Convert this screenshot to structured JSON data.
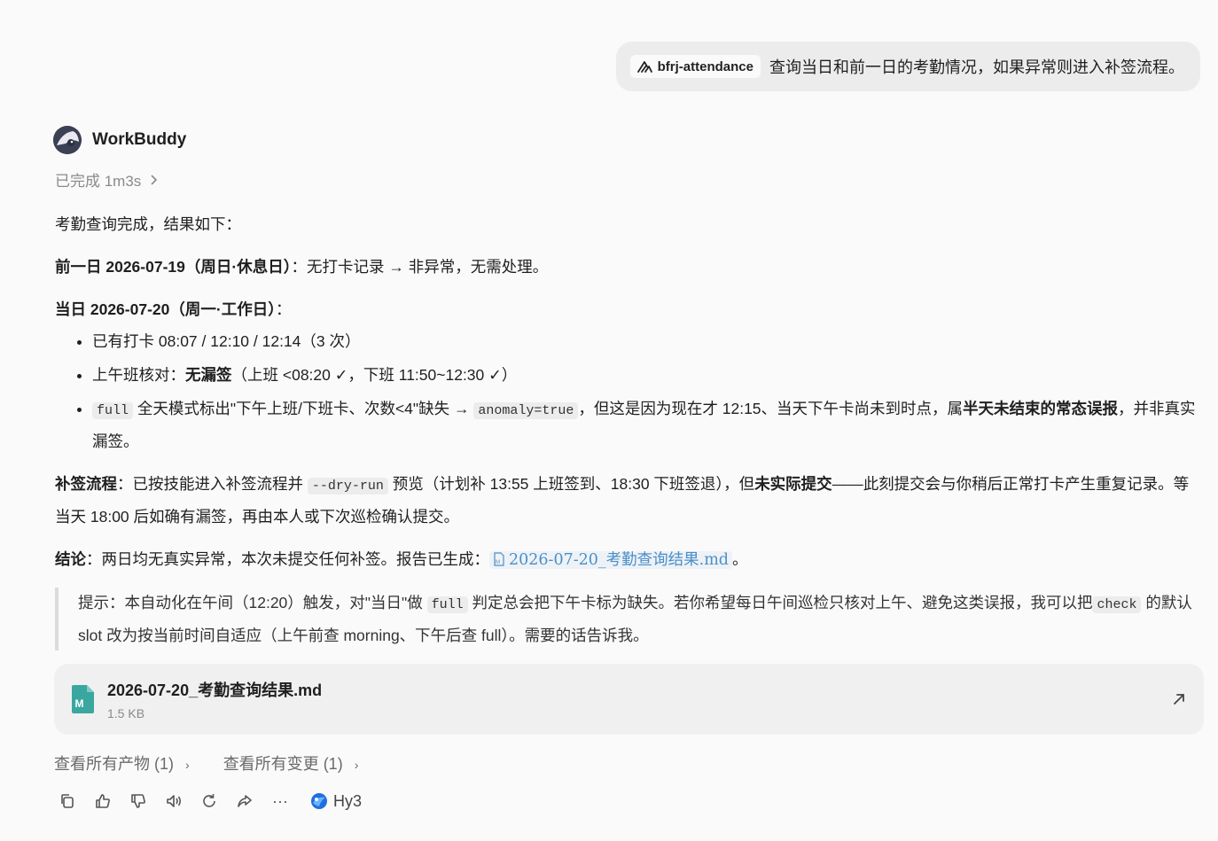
{
  "user_message": {
    "skill_chip": "bfrj-attendance",
    "text": "查询当日和前一日的考勤情况，如果异常则进入补签流程。"
  },
  "assistant": {
    "name": "WorkBuddy",
    "status": "已完成 1m3s"
  },
  "response": {
    "intro": "考勤查询完成，结果如下：",
    "prev_day": {
      "label": "前一日 2026-07-19（周日·休息日）",
      "text": "：无打卡记录 → 非异常，无需处理。"
    },
    "today": {
      "label": "当日 2026-07-20（周一·工作日）",
      "colon": "："
    },
    "bullets": {
      "b1": "已有打卡 08:07 / 12:10 / 12:14（3 次）",
      "b2_pre": "上午班核对：",
      "b2_bold": "无漏签",
      "b2_post": "（上班 <08:20 ✓，下班 11:50~12:30 ✓）",
      "b3_code1": "full",
      "b3_t1": " 全天模式标出\"下午上班/下班卡、次数<4\"缺失 → ",
      "b3_code2": "anomaly=true",
      "b3_t2": "，但这是因为现在才 12:15、当天下午卡尚未到时点，属",
      "b3_bold": "半天未结束的常态误报",
      "b3_t3": "，并非真实漏签。"
    },
    "resign": {
      "label": "补签流程",
      "t1": "：已按技能进入补签流程并 ",
      "code": "--dry-run",
      "t2": " 预览（计划补 13:55 上班签到、18:30 下班签退），但",
      "bold": "未实际提交",
      "t3": "——此刻提交会与你稍后正常打卡产生重复记录。等当天 18:00 后如确有漏签，再由本人或下次巡检确认提交。"
    },
    "conclusion": {
      "label": "结论",
      "t1": "：两日均无真实异常，本次未提交任何补签。报告已生成：",
      "file_link": "2026-07-20_考勤查询结果.md",
      "t2": "。"
    },
    "tip": {
      "t1": "提示：本自动化在午间（12:20）触发，对\"当日\"做 ",
      "code1": "full",
      "t2": " 判定总会把下午卡标为缺失。若你希望每日午间巡检只核对上午、避免这类误报，我可以把",
      "code2": "check",
      "t3": " 的默认 slot 改为按当前时间自适应（上午前查 morning、下午后查 full）。需要的话告诉我。"
    }
  },
  "file_card": {
    "name": "2026-07-20_考勤查询结果.md",
    "size": "1.5 KB"
  },
  "links": {
    "artifacts": "查看所有产物 (1)",
    "changes": "查看所有变更 (1)"
  },
  "toolbar": {
    "model": "Hy3"
  },
  "colors": {
    "link": "#4a8fc9",
    "md_icon": "#3aa6a0"
  }
}
